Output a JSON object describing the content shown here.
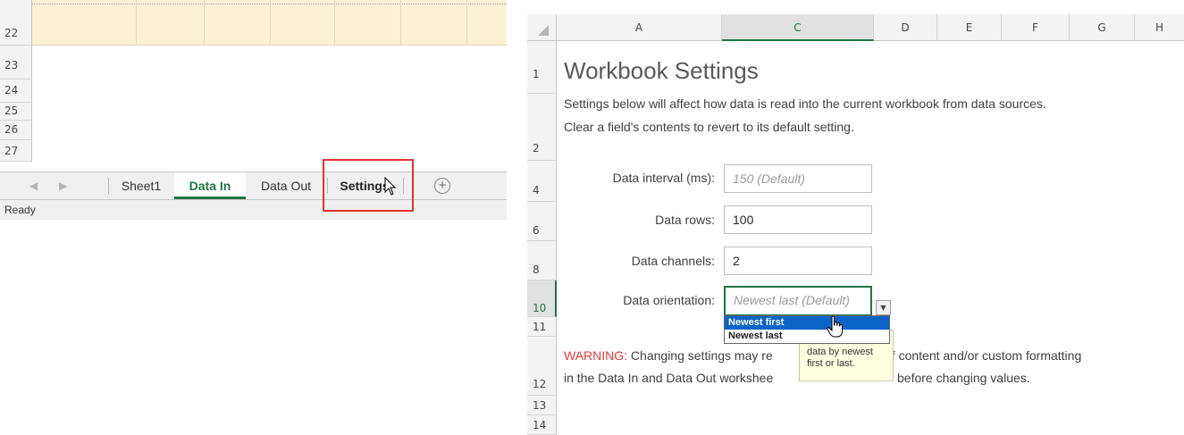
{
  "left_panel": {
    "rows": [
      "22",
      "23",
      "24",
      "25",
      "26",
      "27"
    ],
    "sheet_tabs": [
      "Sheet1",
      "Data In",
      "Data Out",
      "Settings"
    ],
    "active_tab": "Data In",
    "highlighted_tab": "Settings",
    "status": "Ready"
  },
  "right_panel": {
    "columns": [
      "A",
      "C",
      "D",
      "E",
      "F",
      "G",
      "H"
    ],
    "rows": [
      "1",
      "2",
      "4",
      "6",
      "8",
      "10",
      "11",
      "12",
      "13",
      "14"
    ],
    "title": "Workbook Settings",
    "desc_line1": "Settings below will affect how data is read into the current workbook from data sources.",
    "desc_line2": "Clear a field's contents to revert to its default setting.",
    "fields": {
      "interval": {
        "label": "Data interval (ms):",
        "placeholder": "150 (Default)"
      },
      "rows": {
        "label": "Data rows:",
        "value": "100"
      },
      "channels": {
        "label": "Data channels:",
        "value": "2"
      },
      "orientation": {
        "label": "Data orientation:",
        "placeholder": "Newest last (Default)"
      }
    },
    "dropdown_options": [
      "Newest first",
      "Newest last"
    ],
    "selected_option": "Newest first",
    "tooltip": "data by newest first or last.",
    "warning": {
      "label": "WARNING:",
      "line1_a": " Changing settings may re",
      "line1_b": "of content and/or custom formatting",
      "line2_a": "in the Data In and Data Out workshee",
      "line2_b": "before changing values."
    }
  },
  "colors": {
    "accent_green": "#217346",
    "warning_red": "#e53935",
    "selection_blue": "#0a64c8",
    "highlight_box": "#e33232"
  }
}
